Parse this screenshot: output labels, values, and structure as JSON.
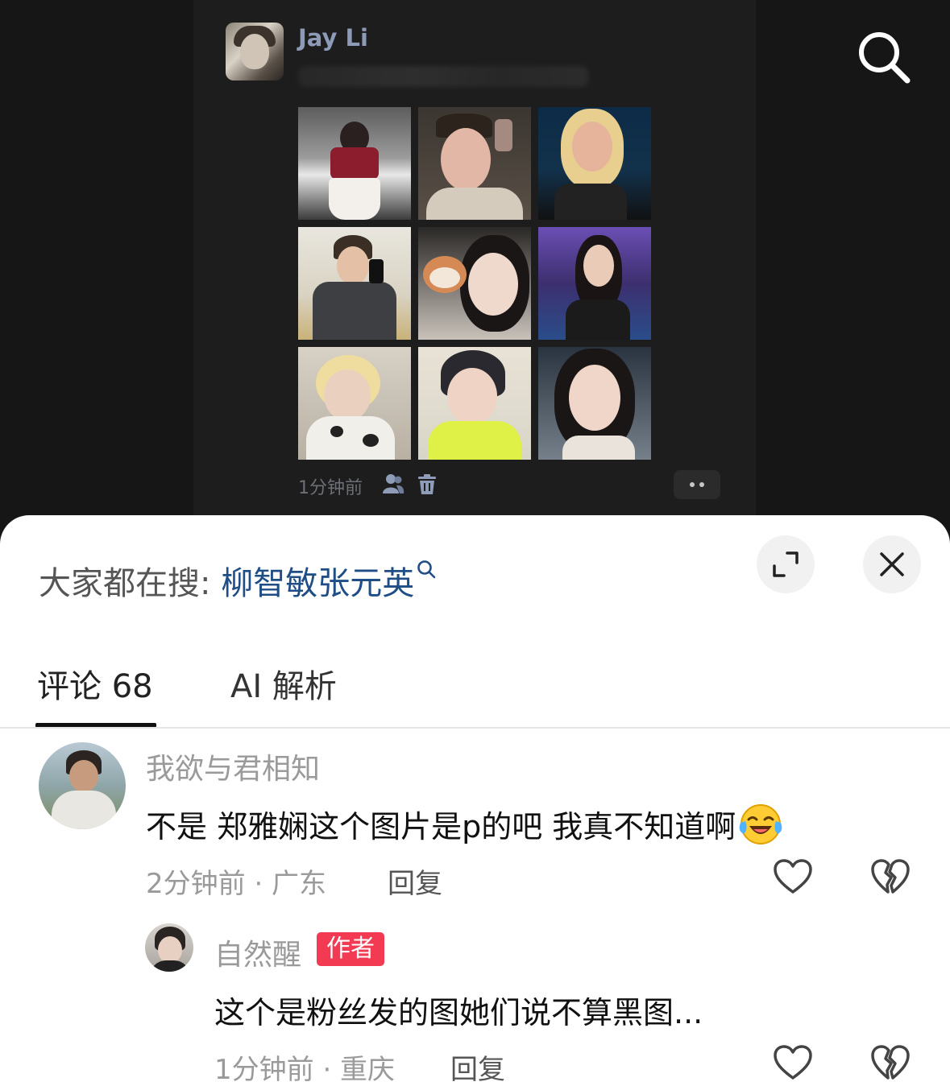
{
  "post": {
    "author_name": "Jay Li",
    "time": "1分钟前",
    "photos": [
      {
        "name": "photo-street",
        "icon": "person-photo"
      },
      {
        "name": "photo-spiky-hair",
        "icon": "person-photo"
      },
      {
        "name": "photo-blonde-stage",
        "icon": "person-photo"
      },
      {
        "name": "photo-mirror-selfie",
        "icon": "person-photo"
      },
      {
        "name": "photo-hamster-selfie",
        "icon": "person-photo"
      },
      {
        "name": "photo-stage-mic",
        "icon": "person-photo"
      },
      {
        "name": "photo-blonde-cow",
        "icon": "person-photo"
      },
      {
        "name": "photo-yellow-shirt",
        "icon": "person-photo"
      },
      {
        "name": "photo-smiling",
        "icon": "person-photo"
      }
    ]
  },
  "sheet": {
    "search_prefix": "大家都在搜: ",
    "search_keyword": "柳智敏张元英",
    "tabs": {
      "comments": "评论 68",
      "ai": "AI 解析"
    }
  },
  "comments": [
    {
      "user": "我欲与君相知",
      "text": "不是  郑雅娴这个图片是p的吧  我真不知道啊",
      "emoji": "laughing-crying-emoji",
      "meta": "2分钟前 · 广东",
      "reply_label": "回复"
    },
    {
      "user": "自然醒",
      "badge": "作者",
      "text": "这个是粉丝发的图她们说不算黑图...",
      "meta": "1分钟前 · 重庆",
      "reply_label": "回复"
    }
  ],
  "colors": {
    "background_dark": "#161616",
    "author_name": "#8d9ab8",
    "keyword_blue": "#1f4d86",
    "author_badge": "#f23b53"
  }
}
